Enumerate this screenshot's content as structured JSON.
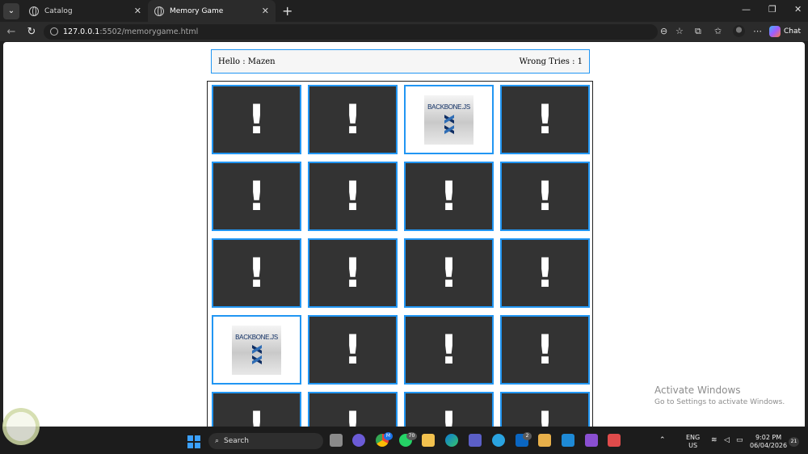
{
  "browser": {
    "tabs": [
      {
        "title": "Catalog",
        "active": false
      },
      {
        "title": "Memory Game",
        "active": true
      }
    ],
    "new_tab_label": "+",
    "window_controls": {
      "minimize": "—",
      "restore": "❐",
      "close": "✕"
    },
    "url_host": "127.0.0.1",
    "url_rest": ":5502/memorygame.html",
    "chat_label": "Chat"
  },
  "game": {
    "greeting": "Hello : Mazen",
    "wrong_tries": "Wrong Tries : 1",
    "hidden_symbol": "!",
    "logo_text": "BACKBONE.JS",
    "cards": [
      {
        "state": "hidden"
      },
      {
        "state": "hidden"
      },
      {
        "state": "flipped"
      },
      {
        "state": "hidden"
      },
      {
        "state": "hidden"
      },
      {
        "state": "hidden"
      },
      {
        "state": "hidden"
      },
      {
        "state": "hidden"
      },
      {
        "state": "hidden"
      },
      {
        "state": "hidden"
      },
      {
        "state": "hidden"
      },
      {
        "state": "hidden"
      },
      {
        "state": "flipped"
      },
      {
        "state": "hidden"
      },
      {
        "state": "hidden"
      },
      {
        "state": "hidden"
      },
      {
        "state": "hidden"
      },
      {
        "state": "hidden"
      },
      {
        "state": "hidden"
      },
      {
        "state": "hidden"
      }
    ],
    "colors": {
      "card_back": "#333333",
      "card_border": "#2196f3",
      "card_front": "#ffffff",
      "logo_blue": "#0f2e63"
    }
  },
  "watermark": {
    "title": "Activate Windows",
    "subtitle": "Go to Settings to activate Windows."
  },
  "taskbar": {
    "search_label": "Search",
    "badges": {
      "chrome": "M",
      "whatsapp": "70",
      "teams": "",
      "linkedin": "2"
    },
    "language_1": "ENG",
    "language_2": "US",
    "time": "9:02 PM",
    "date": "06/04/2026",
    "notification_count": "21"
  }
}
